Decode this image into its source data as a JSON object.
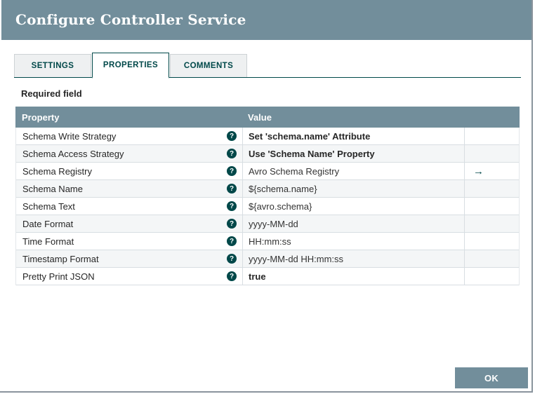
{
  "dialog": {
    "title": "Configure Controller Service"
  },
  "tabs": [
    {
      "label": "SETTINGS",
      "active": false
    },
    {
      "label": "PROPERTIES",
      "active": true
    },
    {
      "label": "COMMENTS",
      "active": false
    }
  ],
  "legend": {
    "required_label": "Required field"
  },
  "table": {
    "columns": {
      "property": "Property",
      "value": "Value"
    },
    "help_icon_glyph": "?",
    "goto_icon_glyph": "→",
    "rows": [
      {
        "property": "Schema Write Strategy",
        "value": "Set 'schema.name' Attribute",
        "required": true,
        "has_goto": false
      },
      {
        "property": "Schema Access Strategy",
        "value": "Use 'Schema Name' Property",
        "required": true,
        "has_goto": false
      },
      {
        "property": "Schema Registry",
        "value": "Avro Schema Registry",
        "required": false,
        "has_goto": true
      },
      {
        "property": "Schema Name",
        "value": "${schema.name}",
        "required": false,
        "has_goto": false
      },
      {
        "property": "Schema Text",
        "value": "${avro.schema}",
        "required": false,
        "has_goto": false
      },
      {
        "property": "Date Format",
        "value": "yyyy-MM-dd",
        "required": false,
        "has_goto": false
      },
      {
        "property": "Time Format",
        "value": "HH:mm:ss",
        "required": false,
        "has_goto": false
      },
      {
        "property": "Timestamp Format",
        "value": "yyyy-MM-dd HH:mm:ss",
        "required": false,
        "has_goto": false
      },
      {
        "property": "Pretty Print JSON",
        "value": "true",
        "required": true,
        "has_goto": false
      }
    ]
  },
  "footer": {
    "ok_label": "OK"
  },
  "colors": {
    "header_bg": "#728E9B",
    "accent_teal": "#004849",
    "row_alt_bg": "#f4f6f7",
    "row_border": "#d8dee2",
    "frame_border": "#8a949d"
  }
}
